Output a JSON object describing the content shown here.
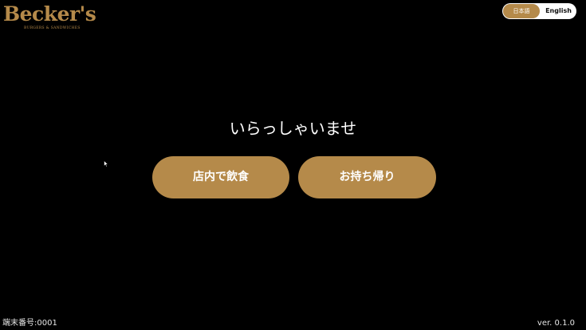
{
  "logo": {
    "name": "Becker's",
    "tagline": "BURGERS & SANDWICHES"
  },
  "language": {
    "japanese_label": "日本語",
    "english_label": "English",
    "selected": "日本語"
  },
  "main": {
    "welcome": "いらっしゃいませ",
    "eat_in_label": "店内で飲食",
    "takeout_label": "お持ち帰り"
  },
  "footer": {
    "terminal_label": "端末番号:0001",
    "version": "ver. 0.1.0"
  },
  "colors": {
    "background": "#000000",
    "accent": "#b58a4a",
    "text": "#ffffff"
  }
}
